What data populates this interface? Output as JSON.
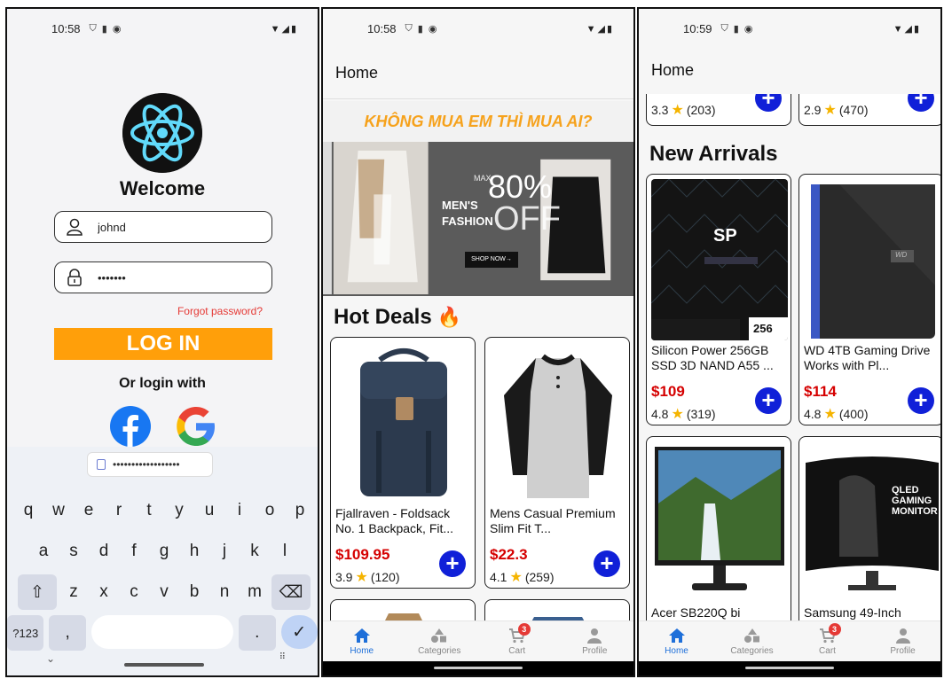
{
  "login": {
    "status": {
      "time": "10:58"
    },
    "welcome": "Welcome",
    "username": {
      "value": "johnd"
    },
    "password": {
      "value": "•••••••"
    },
    "forgot": "Forgot password?",
    "login_button": "LOG IN",
    "or_login_with": "Or login with",
    "suggestion": "••••••••••••••••••",
    "keyboard": {
      "row1": [
        "q",
        "w",
        "e",
        "r",
        "t",
        "y",
        "u",
        "i",
        "o",
        "p"
      ],
      "row2": [
        "a",
        "s",
        "d",
        "f",
        "g",
        "h",
        "j",
        "k",
        "l"
      ],
      "row3": [
        "z",
        "x",
        "c",
        "v",
        "b",
        "n",
        "m"
      ],
      "sym_key": "?123",
      "comma_key": ",",
      "period_key": "."
    }
  },
  "home": {
    "status": {
      "time": "10:58"
    },
    "title": "Home",
    "slogan": "KHÔNG MUA EM THÌ MUA AI?",
    "banner": {
      "max": "MAX",
      "percent": "80%",
      "off": "OFF",
      "line1": "MEN'S",
      "line2": "FASHION",
      "cta": "SHOP NOW→"
    },
    "hot_deals": "Hot Deals",
    "products": [
      {
        "title": "Fjallraven - Foldsack No. 1 Backpack, Fit...",
        "price": "$109.95",
        "rating": "3.9",
        "count": "(120)"
      },
      {
        "title": "Mens Casual Premium Slim Fit T...",
        "price": "$22.3",
        "rating": "4.1",
        "count": "(259)"
      }
    ]
  },
  "home2": {
    "status": {
      "time": "10:59"
    },
    "title": "Home",
    "top_ratings": [
      {
        "rating": "3.3",
        "count": "(203)"
      },
      {
        "rating": "2.9",
        "count": "(470)"
      }
    ],
    "new_arrivals": "New Arrivals",
    "products": [
      {
        "title": "Silicon Power 256GB SSD 3D NAND A55 ...",
        "price": "$109",
        "rating": "4.8",
        "count": "(319)"
      },
      {
        "title": "WD 4TB Gaming Drive Works with Pl...",
        "price": "$114",
        "rating": "4.8",
        "count": "(400)"
      },
      {
        "title": "Acer SB220Q bi",
        "price": "",
        "rating": "",
        "count": ""
      },
      {
        "title": "Samsung 49-Inch",
        "price": "",
        "rating": "",
        "count": ""
      }
    ],
    "ssd_label": "256",
    "wd_label": "WD",
    "monitor_label": "QLED GAMING MONITOR"
  },
  "nav": {
    "home": "Home",
    "categories": "Categories",
    "cart": "Cart",
    "profile": "Profile",
    "cart_badge": "3"
  },
  "colors": {
    "accent": "#ff9f0a",
    "price": "#d50000",
    "add": "#1020d8",
    "active_nav": "#1e6fd9"
  }
}
